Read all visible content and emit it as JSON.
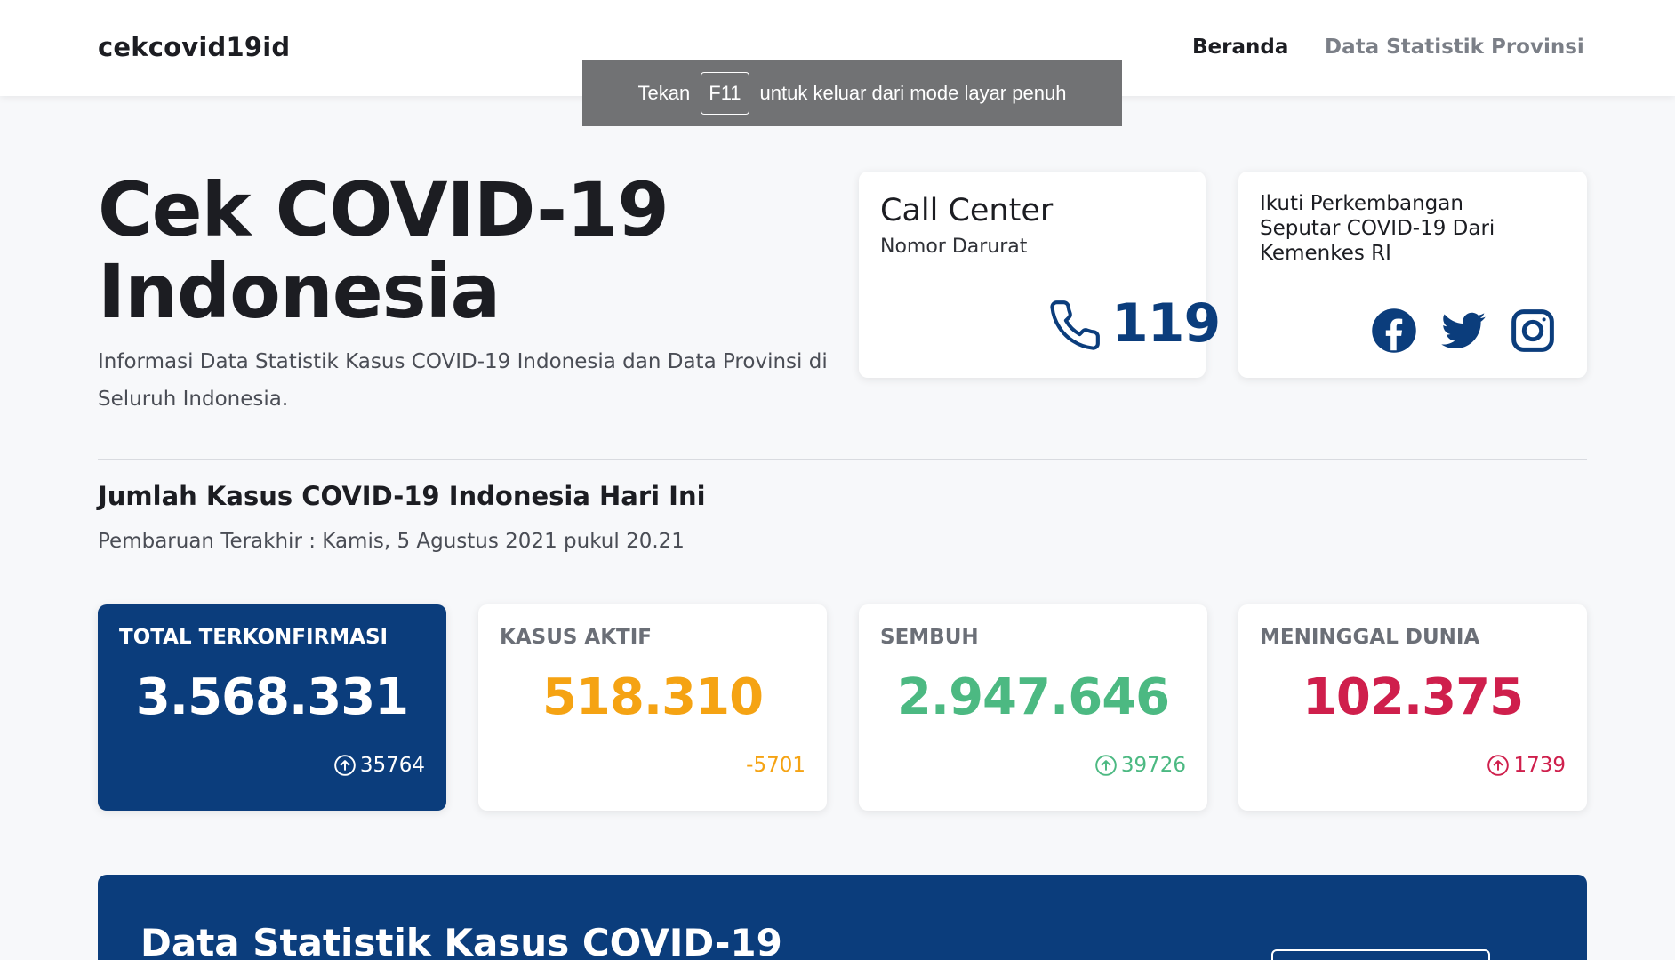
{
  "navbar": {
    "brand": "cekcovid19id",
    "links": [
      "Beranda",
      "Data Statistik Provinsi"
    ]
  },
  "toast": {
    "prefix": "Tekan",
    "key": "F11",
    "suffix": "untuk keluar dari mode layar penuh"
  },
  "hero": {
    "title": "Cek COVID-19 Indonesia",
    "subtitle": "Informasi Data Statistik Kasus COVID-19 Indonesia dan Data Provinsi di Seluruh Indonesia."
  },
  "call_center": {
    "title": "Call Center",
    "subtitle": "Nomor Darurat",
    "number": "119",
    "icon": "phone-icon"
  },
  "follow": {
    "text": "Ikuti Perkembangan Seputar COVID-19 Dari Kemenkes RI",
    "icons": [
      "facebook-icon",
      "twitter-icon",
      "instagram-icon"
    ]
  },
  "cases": {
    "title": "Jumlah Kasus COVID-19 Indonesia Hari Ini",
    "updated": "Pembaruan Terakhir : Kamis, 5 Agustus 2021 pukul 20.21",
    "stats": [
      {
        "label": "TOTAL TERKONFIRMASI",
        "value": "3.568.331",
        "delta": "35764",
        "delta_icon": "arrow-up-circle-icon",
        "color": "#ffffff"
      },
      {
        "label": "KASUS AKTIF",
        "value": "518.310",
        "delta": "-5701",
        "delta_icon": "",
        "color": "#f5a313"
      },
      {
        "label": "SEMBUH",
        "value": "2.947.646",
        "delta": "39726",
        "delta_icon": "arrow-up-circle-icon",
        "color": "#4cb982"
      },
      {
        "label": "MENINGGAL DUNIA",
        "value": "102.375",
        "delta": "1739",
        "delta_icon": "arrow-up-circle-icon",
        "color": "#cf1f4c"
      }
    ]
  },
  "banner": {
    "title": "Data Statistik Kasus COVID-19"
  },
  "colors": {
    "primary": "#0b3d7c",
    "active": "#f5a313",
    "recovered": "#4cb982",
    "deaths": "#cf1f4c"
  }
}
